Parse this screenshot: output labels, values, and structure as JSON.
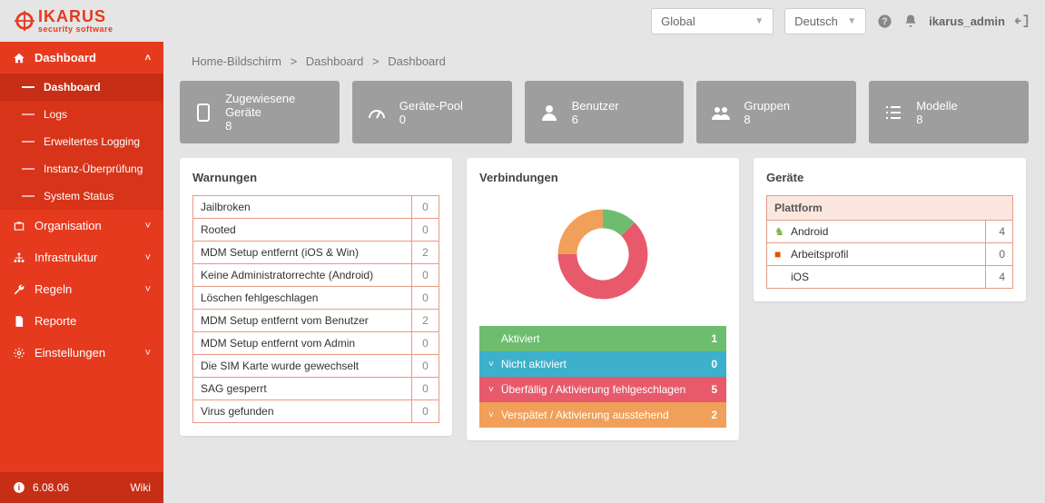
{
  "header": {
    "brand_main": "IKARUS",
    "brand_sub": "security software",
    "scope": "Global",
    "language": "Deutsch",
    "username": "ikarus_admin"
  },
  "sidebar": {
    "main": {
      "label": "Dashboard",
      "sub": [
        {
          "label": "Dashboard",
          "active": true
        },
        {
          "label": "Logs"
        },
        {
          "label": "Erweitertes Logging"
        },
        {
          "label": "Instanz-Überprüfung"
        },
        {
          "label": "System Status"
        }
      ]
    },
    "groups": [
      {
        "label": "Organisation",
        "icon": "briefcase"
      },
      {
        "label": "Infrastruktur",
        "icon": "network"
      },
      {
        "label": "Regeln",
        "icon": "wrench"
      },
      {
        "label": "Reporte",
        "icon": "file",
        "nochev": true
      },
      {
        "label": "Einstellungen",
        "icon": "gear"
      }
    ],
    "version": "6.08.06",
    "wiki": "Wiki"
  },
  "breadcrumb": [
    "Home-Bildschirm",
    "Dashboard",
    "Dashboard"
  ],
  "stats": [
    {
      "label": "Zugewiesene Geräte",
      "value": "8",
      "icon": "tablet"
    },
    {
      "label": "Geräte-Pool",
      "value": "0",
      "icon": "gauge"
    },
    {
      "label": "Benutzer",
      "value": "6",
      "icon": "user"
    },
    {
      "label": "Gruppen",
      "value": "8",
      "icon": "users"
    },
    {
      "label": "Modelle",
      "value": "8",
      "icon": "list"
    }
  ],
  "warnings": {
    "title": "Warnungen",
    "rows": [
      {
        "label": "Jailbroken",
        "count": "0"
      },
      {
        "label": "Rooted",
        "count": "0"
      },
      {
        "label": "MDM Setup entfernt (iOS & Win)",
        "count": "2"
      },
      {
        "label": "Keine Administratorrechte (Android)",
        "count": "0"
      },
      {
        "label": "Löschen fehlgeschlagen",
        "count": "0"
      },
      {
        "label": "MDM Setup entfernt vom Benutzer",
        "count": "2"
      },
      {
        "label": "MDM Setup entfernt vom Admin",
        "count": "0"
      },
      {
        "label": "Die SIM Karte wurde gewechselt",
        "count": "0"
      },
      {
        "label": "SAG gesperrt",
        "count": "0"
      },
      {
        "label": "Virus gefunden",
        "count": "0"
      }
    ]
  },
  "connections": {
    "title": "Verbindungen",
    "rows": [
      {
        "label": "Aktiviert",
        "count": "1",
        "class": "conn-green",
        "expandable": false
      },
      {
        "label": "Nicht aktiviert",
        "count": "0",
        "class": "conn-blue",
        "expandable": true
      },
      {
        "label": "Überfällig / Aktivierung fehlgeschlagen",
        "count": "5",
        "class": "conn-red",
        "expandable": true
      },
      {
        "label": "Verspätet / Aktivierung ausstehend",
        "count": "2",
        "class": "conn-orange",
        "expandable": true
      }
    ]
  },
  "devices": {
    "title": "Geräte",
    "header": "Plattform",
    "rows": [
      {
        "label": "Android",
        "count": "4",
        "iconClass": "plat-android",
        "glyph": "♞"
      },
      {
        "label": "Arbeitsprofil",
        "count": "0",
        "iconClass": "plat-work",
        "glyph": "■"
      },
      {
        "label": "iOS",
        "count": "4",
        "iconClass": "plat-ios",
        "glyph": ""
      }
    ]
  },
  "chart_data": {
    "type": "pie",
    "title": "Verbindungen",
    "series": [
      {
        "name": "Aktiviert",
        "value": 1,
        "color": "#6ebd6e"
      },
      {
        "name": "Überfällig / Aktivierung fehlgeschlagen",
        "value": 5,
        "color": "#e85a6b"
      },
      {
        "name": "Verspätet / Aktivierung ausstehend",
        "value": 2,
        "color": "#f0a059"
      }
    ]
  }
}
